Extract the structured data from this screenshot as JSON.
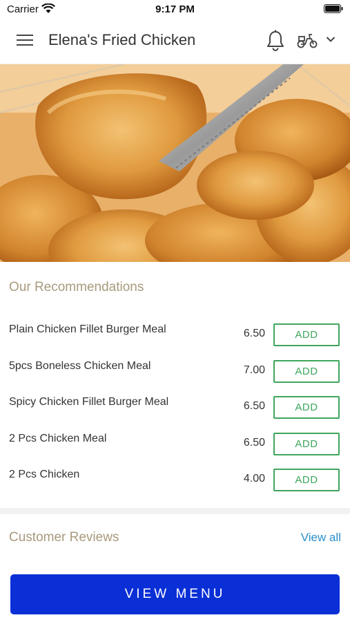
{
  "status_bar": {
    "carrier": "Carrier",
    "time": "9:17 PM"
  },
  "header": {
    "title": "Elena's Fried Chicken"
  },
  "recommendations": {
    "title": "Our Recommendations",
    "items": [
      {
        "name": "Plain Chicken Fillet Burger Meal",
        "price": "6.50",
        "button": "ADD"
      },
      {
        "name": "5pcs Boneless Chicken Meal",
        "price": "7.00",
        "button": "ADD"
      },
      {
        "name": "Spicy Chicken Fillet Burger Meal",
        "price": "6.50",
        "button": "ADD"
      },
      {
        "name": "2 Pcs Chicken Meal",
        "price": "6.50",
        "button": "ADD"
      },
      {
        "name": "2 Pcs Chicken",
        "price": "4.00",
        "button": "ADD"
      }
    ]
  },
  "reviews": {
    "title": "Customer Reviews",
    "view_all": "View all"
  },
  "footer": {
    "button_label": "VIEW MENU"
  },
  "colors": {
    "primary": "#0a2fd6",
    "add_green": "#3ea65c",
    "link": "#2a8fc9",
    "section_title": "#a89a7c"
  },
  "icons": [
    "wifi-icon",
    "battery-icon",
    "menu-icon",
    "bell-icon",
    "scooter-icon",
    "chevron-down-icon"
  ]
}
